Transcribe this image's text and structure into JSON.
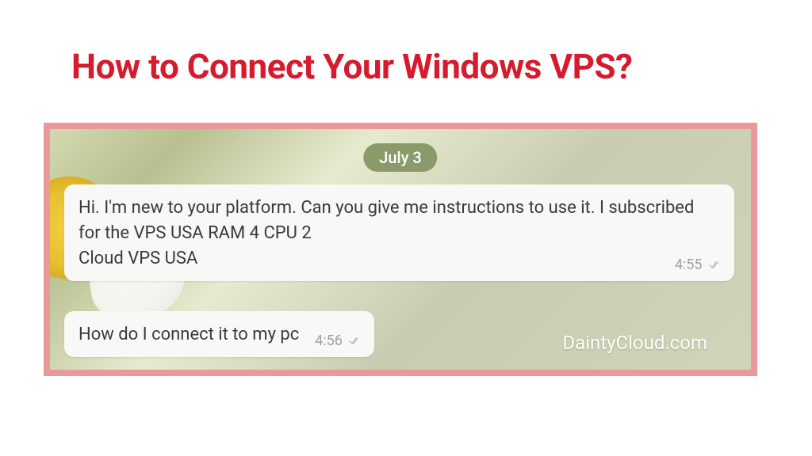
{
  "title": "How to Connect Your Windows VPS?",
  "chat": {
    "date_label": "July 3",
    "messages": [
      {
        "text": "Hi. I'm new to your platform. Can you give me instructions to use it. I subscribed for the VPS USA RAM 4 CPU 2\nCloud VPS USA",
        "time": "4:55"
      },
      {
        "text": "How do I connect it to my pc",
        "time": "4:56"
      }
    ]
  },
  "watermark": "DaintyCloud.com",
  "colors": {
    "title": "#d71b2e",
    "frame_border": "#e89a9a",
    "date_badge_bg": "#8a9a6a",
    "bubble_bg": "#f8f8f6"
  }
}
